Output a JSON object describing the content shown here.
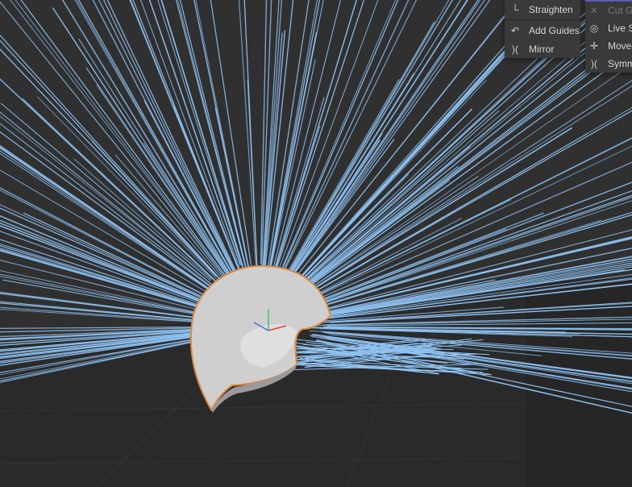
{
  "tools_menu": {
    "items": [
      {
        "label": "Straighten",
        "icon": "straighten-icon"
      },
      {
        "label": "Add Guides",
        "icon": "add-guides-icon"
      },
      {
        "label": "Mirror",
        "icon": "mirror-icon"
      }
    ]
  },
  "tools_menu_2": {
    "items": [
      {
        "label": "Cut Gu",
        "icon": "cut-guides-icon",
        "disabled": true
      },
      {
        "label": "Live Se",
        "icon": "live-selection-icon"
      },
      {
        "label": "Move",
        "icon": "move-icon"
      },
      {
        "label": "Symme",
        "icon": "symmetry-icon"
      }
    ]
  },
  "colors": {
    "background": "#2f2f2f",
    "floor": "#2a2a2a",
    "hair_guides": "#8fc2f2",
    "mesh_edge": "#e08a3c",
    "menu_bg": "#3a3a3a",
    "menu_text": "#d6d6d6",
    "menu_accent": "#5a5fb0"
  }
}
